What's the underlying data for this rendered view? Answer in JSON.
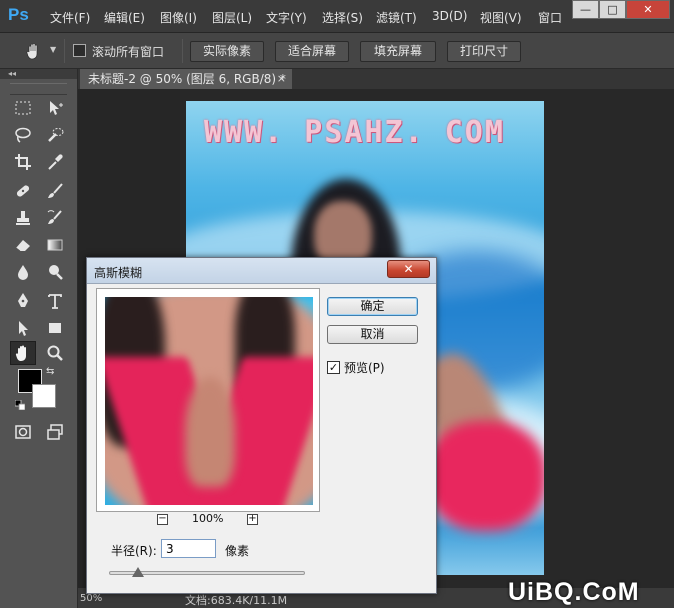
{
  "app": {
    "logo": "Ps",
    "menus": [
      "文件(F)",
      "编辑(E)",
      "图像(I)",
      "图层(L)",
      "文字(Y)",
      "选择(S)",
      "滤镜(T)",
      "3D(D)",
      "视图(V)",
      "窗口"
    ],
    "window_buttons": {
      "minimize": "—",
      "maximize": "□",
      "close": "✕"
    }
  },
  "options_bar": {
    "scroll_all_label": "滚动所有窗口",
    "scroll_all_checked": false,
    "buttons": [
      "实际像素",
      "适合屏幕",
      "填充屏幕",
      "打印尺寸"
    ]
  },
  "document": {
    "tab_title": "未标题-2 @ 50% (图层 6, RGB/8) *",
    "tab_close": "×",
    "watermark_text": "WWW. PSAHZ. COM",
    "zoom_readout": "50%",
    "status_text": "文档:683.4K/11.1M"
  },
  "toolbox": {
    "collapse_label": "◂◂",
    "foreground_color": "#000000",
    "background_color": "#ffffff"
  },
  "dialog": {
    "title": "高斯模糊",
    "close_label": "✕",
    "ok_label": "确定",
    "cancel_label": "取消",
    "preview_label": "预览(P)",
    "preview_checked": true,
    "zoom_level": "100%",
    "zoom_minus": "−",
    "zoom_plus": "+",
    "radius_label": "半径(R):",
    "radius_value": "3",
    "radius_unit": "像素",
    "slider_position": 0.15
  },
  "site_logo": "UiBQ.CoM"
}
